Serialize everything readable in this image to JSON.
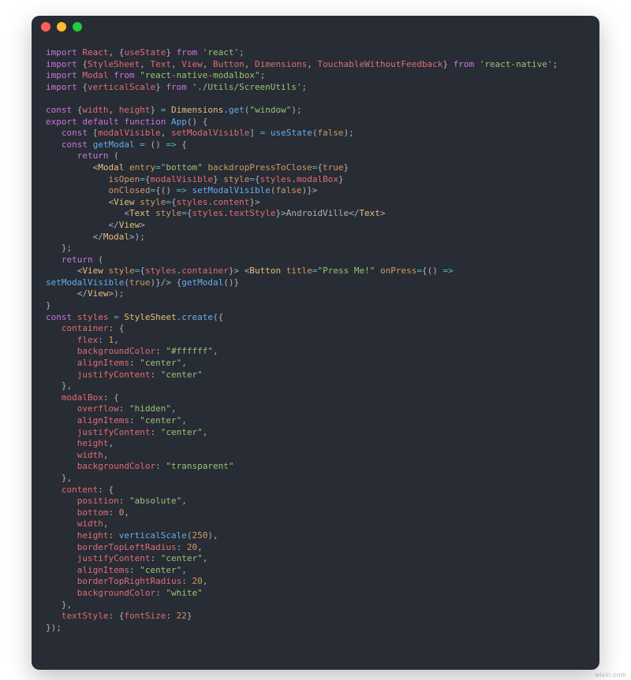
{
  "watermark": "wixin.com",
  "titlebar": {
    "red": "#ff5f56",
    "yellow": "#ffbd2e",
    "green": "#27c93f"
  },
  "tokens": {
    "kw_import": "import",
    "kw_from": "from",
    "kw_const": "const",
    "kw_export": "export",
    "kw_default": "default",
    "kw_function": "function",
    "kw_return": "return",
    "id_React": "React",
    "id_useState": "useState",
    "id_StyleSheet": "StyleSheet",
    "id_Text": "Text",
    "id_View": "View",
    "id_Button": "Button",
    "id_Dimensions": "Dimensions",
    "id_TouchableWithoutFeedback": "TouchableWithoutFeedback",
    "id_Modal": "Modal",
    "id_verticalScale": "verticalScale",
    "id_width": "width",
    "id_height": "height",
    "id_App": "App",
    "id_modalVisible": "modalVisible",
    "id_setModalVisible": "setModalVisible",
    "id_getModal": "getModal",
    "id_styles": "styles",
    "str_react": "'react'",
    "str_react_native": "'react-native'",
    "str_modalbox": "\"react-native-modalbox\"",
    "str_screenutils": "'./Utils/ScreenUtils'",
    "str_window": "\"window\"",
    "str_bottom": "\"bottom\"",
    "str_press_me": "\"Press Me!\"",
    "str_ffffff": "\"#ffffff\"",
    "str_center": "\"center\"",
    "str_hidden": "\"hidden\"",
    "str_transparent": "\"transparent\"",
    "str_absolute": "\"absolute\"",
    "str_white": "\"white\"",
    "num_false": "false",
    "num_true": "true",
    "num_1": "1",
    "num_0": "0",
    "num_250": "250",
    "num_20": "20",
    "num_22": "22",
    "attr_entry": "entry",
    "attr_backdropPressToClose": "backdropPressToClose",
    "attr_isOpen": "isOpen",
    "attr_style": "style",
    "attr_onClosed": "onClosed",
    "attr_title": "title",
    "attr_onPress": "onPress",
    "prop_modalBox": "modalBox",
    "prop_content": "content",
    "prop_textStyle": "textStyle",
    "prop_container": "container",
    "prop_flex": "flex",
    "prop_backgroundColor": "backgroundColor",
    "prop_alignItems": "alignItems",
    "prop_justifyContent": "justifyContent",
    "prop_overflow": "overflow",
    "prop_position": "position",
    "prop_bottom": "bottom",
    "prop_borderTopLeftRadius": "borderTopLeftRadius",
    "prop_borderTopRightRadius": "borderTopRightRadius",
    "prop_fontSize": "fontSize",
    "jsx_text_AndroidVille": "AndroidVille",
    "fn_get": "get",
    "fn_create": "create"
  }
}
